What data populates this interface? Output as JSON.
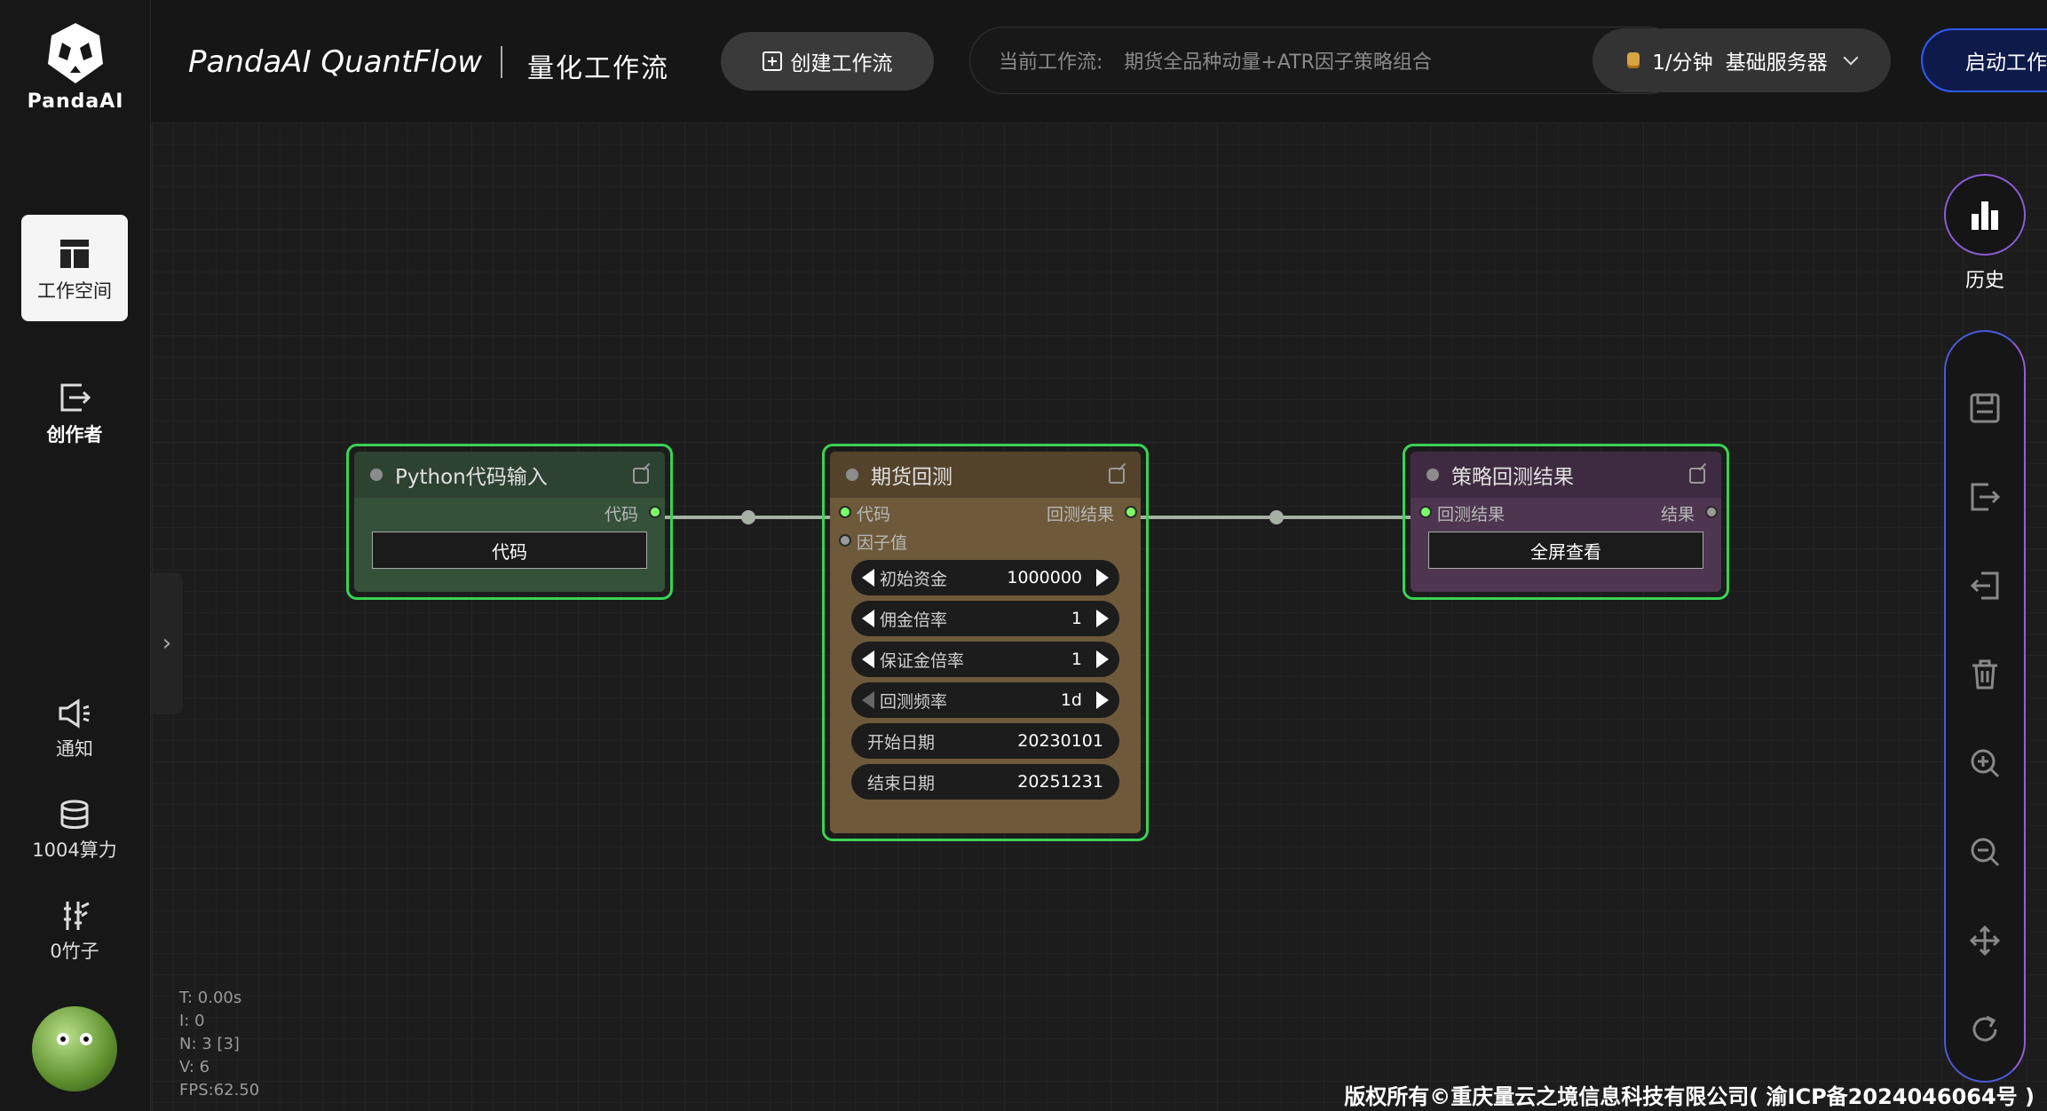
{
  "brand": {
    "logo_text": "PandaAI",
    "app_title": "PandaAI QuantFlow",
    "subtitle": "量化工作流"
  },
  "sidebar": {
    "items": [
      {
        "label": "工作空间",
        "icon": "layout-icon",
        "active": true
      },
      {
        "label": "创作者",
        "icon": "exit-icon",
        "active": false
      },
      {
        "label": "通知",
        "icon": "speaker-icon",
        "active": false
      },
      {
        "label": "1004算力",
        "icon": "database-icon",
        "active": false
      },
      {
        "label": "0竹子",
        "icon": "bamboo-icon",
        "active": false
      }
    ],
    "collapse_glyph": "›"
  },
  "header": {
    "create_button": "创建工作流",
    "workflow_label": "当前工作流:",
    "workflow_name": "期货全品种动量+ATR因子策略组合",
    "server_price": "1/分钟",
    "server_name": "基础服务器",
    "start_button": "启动工作"
  },
  "nodes": {
    "python": {
      "title": "Python代码输入",
      "output_label": "代码",
      "button": "代码"
    },
    "backtest": {
      "title": "期货回测",
      "input_code": "代码",
      "input_factor": "因子值",
      "output_label": "回测结果",
      "widgets": [
        {
          "label": "初始资金",
          "value": "1000000"
        },
        {
          "label": "佣金倍率",
          "value": "1"
        },
        {
          "label": "保证金倍率",
          "value": "1"
        },
        {
          "label": "回测频率",
          "value": "1d"
        }
      ],
      "start_date_label": "开始日期",
      "start_date": "20230101",
      "end_date_label": "结束日期",
      "end_date": "20251231"
    },
    "result": {
      "title": "策略回测结果",
      "input_label": "回测结果",
      "output_label": "结果",
      "button": "全屏查看"
    }
  },
  "toolbar": {
    "history_label": "历史"
  },
  "stats": {
    "t": "T: 0.00s",
    "i": "I: 0",
    "n": "N: 3 [3]",
    "v": "V: 6",
    "fps": "FPS:62.50"
  },
  "footer": "版权所有©重庆量云之境信息科技有限公司( 渝ICP备2024046064号 )",
  "colors": {
    "node_border": "#39d353",
    "python_node": "#35513a",
    "backtest_node": "#6e5a3a",
    "result_node": "#4e3650",
    "start_border": "#2f5bff"
  }
}
